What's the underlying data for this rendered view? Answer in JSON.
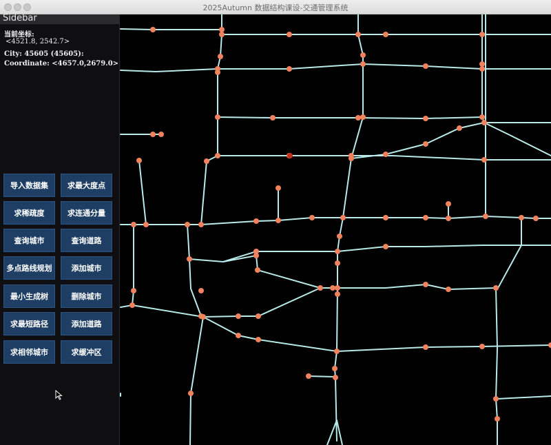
{
  "window": {
    "title": "2025Autumn 数据结构课设-交通管理系统"
  },
  "sidebar": {
    "title": "Sidebar",
    "current_coord_label": "当前坐标:",
    "current_coord_value": "<4521.8, 2542.7>",
    "city_line": "City: 45605 (45605):",
    "coordinate_line": "Coordinate: <4657.0,2679.0>",
    "buttons": [
      {
        "label": "导入数据集"
      },
      {
        "label": "求最大度点"
      },
      {
        "label": "求稀疏度"
      },
      {
        "label": "求连通分量"
      },
      {
        "label": "查询城市"
      },
      {
        "label": "查询道路"
      },
      {
        "label": "多点路线规划"
      },
      {
        "label": "添加城市"
      },
      {
        "label": "最小生成树"
      },
      {
        "label": "删除城市"
      },
      {
        "label": "求最短路径"
      },
      {
        "label": "添加道路"
      },
      {
        "label": "求相邻城市"
      },
      {
        "label": "求缓冲区"
      }
    ]
  },
  "map": {
    "road_color": "#b8eaea",
    "node_color": "#f0825e",
    "selected_node_color": "#c0301a"
  }
}
